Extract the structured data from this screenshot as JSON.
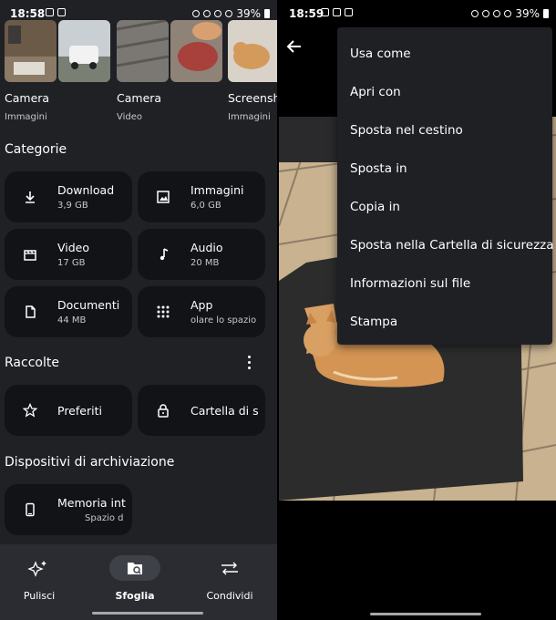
{
  "left_status": {
    "time": "18:58",
    "battery": "39%"
  },
  "right_status": {
    "time": "18:59",
    "battery": "39%"
  },
  "albums": [
    {
      "name": "Camera",
      "sub": "Immagini"
    },
    {
      "name": "Camera",
      "sub": "Video"
    },
    {
      "name": "Screenshe",
      "sub": "Immagini"
    }
  ],
  "categories": {
    "title": "Categorie",
    "items": [
      {
        "title": "Download",
        "sub": "3,9 GB",
        "icon": "download-icon"
      },
      {
        "title": "Immagini",
        "sub": "6,0 GB",
        "icon": "image-icon"
      },
      {
        "title": "Video",
        "sub": "17 GB",
        "icon": "video-icon"
      },
      {
        "title": "Audio",
        "sub": "20 MB",
        "icon": "music-note-icon"
      },
      {
        "title": "Documenti",
        "sub": "44 MB",
        "icon": "document-icon"
      },
      {
        "title": "App",
        "sub": "olare lo spazio",
        "icon": "apps-grid-icon"
      }
    ]
  },
  "collections": {
    "title": "Raccolte",
    "items": [
      {
        "title": "Preferiti",
        "icon": "star-icon"
      },
      {
        "title": "Cartella di s",
        "icon": "lock-icon"
      }
    ]
  },
  "storage": {
    "title": "Dispositivi di archiviazione",
    "items": [
      {
        "title": "Memoria int",
        "sub": "Spazio d",
        "icon": "phone-icon"
      }
    ]
  },
  "nav": [
    {
      "label": "Pulisci",
      "icon": "sparkle-icon"
    },
    {
      "label": "Sfoglia",
      "icon": "browse-folder-icon",
      "active": true
    },
    {
      "label": "Condividi",
      "icon": "share-swap-icon"
    }
  ],
  "menu": [
    "Usa come",
    "Apri con",
    "Sposta nel cestino",
    "Sposta in",
    "Copia in",
    "Sposta nella Cartella di sicurezza",
    "Informazioni sul file",
    "Stampa"
  ]
}
